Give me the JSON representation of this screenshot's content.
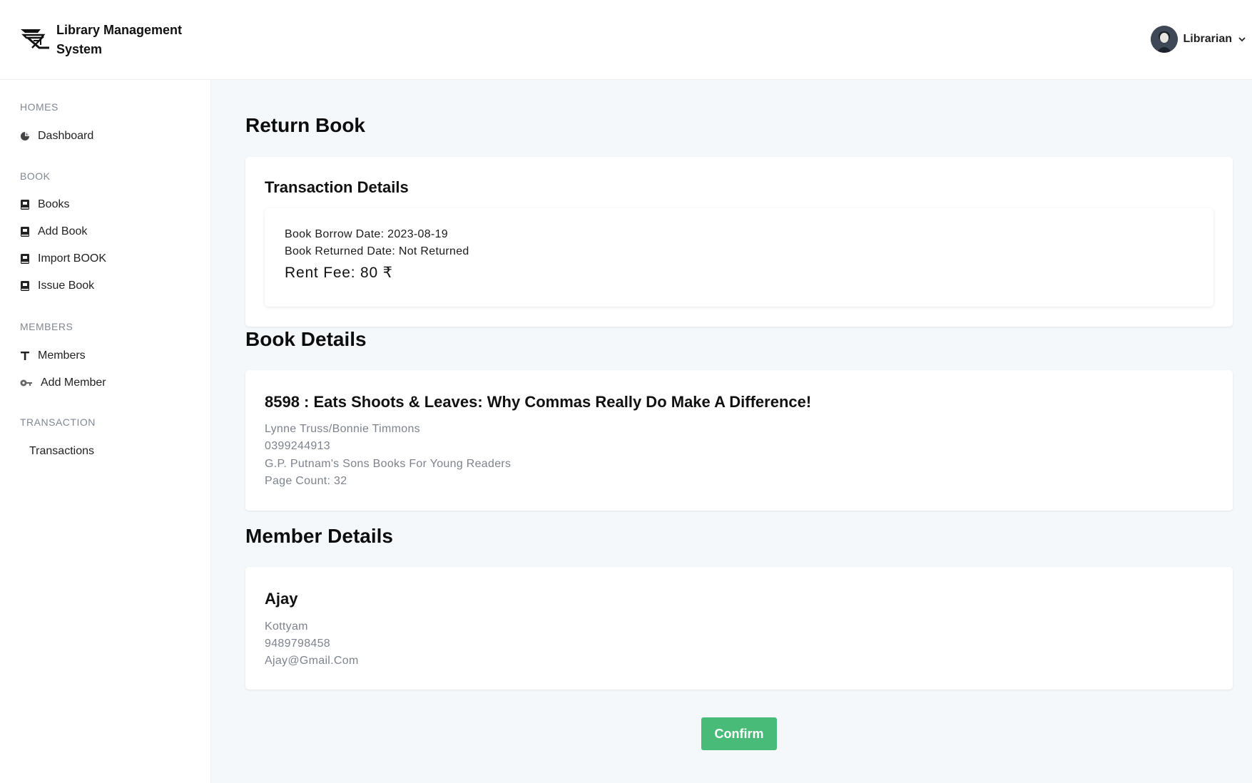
{
  "header": {
    "app_title": "Library Management System",
    "user_name": "Librarian"
  },
  "sidebar": {
    "sections": [
      {
        "label": "HOMES",
        "items": [
          {
            "label": "Dashboard",
            "icon": "pie-chart-icon"
          }
        ]
      },
      {
        "label": "BOOK",
        "items": [
          {
            "label": "Books",
            "icon": "book-icon"
          },
          {
            "label": "Add Book",
            "icon": "book-icon"
          },
          {
            "label": "Import BOOK",
            "icon": "book-icon"
          },
          {
            "label": "Issue Book",
            "icon": "book-icon"
          }
        ]
      },
      {
        "label": "MEMBERS",
        "items": [
          {
            "label": "Members",
            "icon": "text-t-icon"
          },
          {
            "label": "Add Member",
            "icon": "key-icon"
          }
        ]
      },
      {
        "label": "TRANSACTION",
        "items": [
          {
            "label": "Transactions",
            "icon": ""
          }
        ]
      }
    ]
  },
  "main": {
    "page_title": "Return Book",
    "transaction": {
      "title": "Transaction Details",
      "borrow_date": "Book Borrow Date: 2023-08-19",
      "returned_date": "Book Returned Date: Not Returned",
      "rent_fee": "Rent Fee: 80 ₹"
    },
    "book": {
      "section_title": "Book Details",
      "title": "8598 : Eats Shoots & Leaves: Why Commas Really Do Make A Difference!",
      "authors": "Lynne Truss/Bonnie Timmons",
      "isbn": "0399244913",
      "publisher": "G.P. Putnam's Sons Books For Young Readers",
      "page_count": "Page Count: 32"
    },
    "member": {
      "section_title": "Member Details",
      "name": "Ajay",
      "city": "Kottyam",
      "phone": "9489798458",
      "email": "Ajay@Gmail.Com"
    },
    "confirm_label": "Confirm"
  },
  "colors": {
    "accent_green": "#48bb78",
    "background": "#f5f8fb",
    "muted_text": "#7d838d"
  }
}
